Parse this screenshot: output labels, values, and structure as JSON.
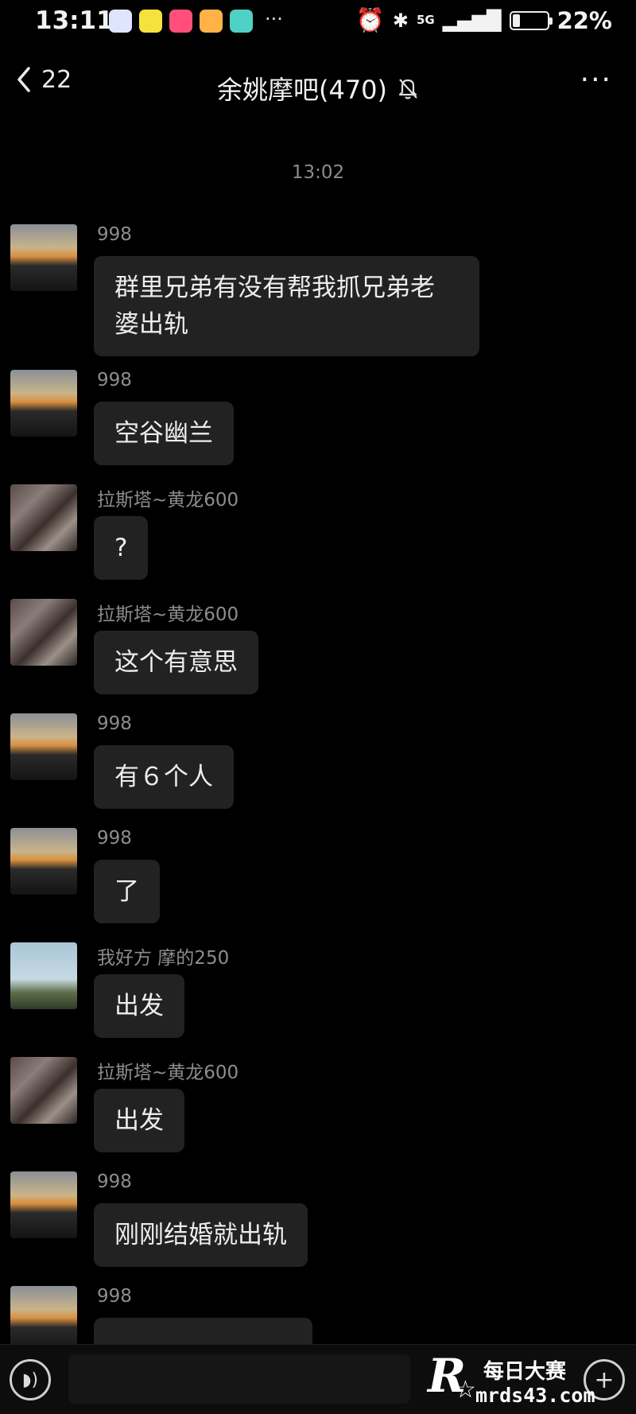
{
  "status_bar": {
    "time": "13:11",
    "network": "5G",
    "battery": "22%",
    "battery_level": 0.22,
    "app_icons": [
      "baidu-icon",
      "vip-icon",
      "video-icon",
      "game-icon",
      "message-icon"
    ]
  },
  "header": {
    "back_count": "22",
    "title": "余姚摩吧(470)",
    "mute_icon": "bell-off-icon",
    "more": "···"
  },
  "time_separator": "13:02",
  "messages": [
    {
      "sender": "998",
      "text": "群里兄弟有没有帮我抓兄弟老婆出轨",
      "avatar": "sunset"
    },
    {
      "sender": "998",
      "text": "空谷幽兰",
      "avatar": "sunset"
    },
    {
      "sender": "拉斯塔~黄龙600",
      "text": "?",
      "avatar": "motorbike"
    },
    {
      "sender": "拉斯塔~黄龙600",
      "text": "这个有意思",
      "avatar": "motorbike"
    },
    {
      "sender": "998",
      "text": "有６个人",
      "avatar": "sunset"
    },
    {
      "sender": "998",
      "text": "了",
      "avatar": "sunset"
    },
    {
      "sender": "我好方 摩的250",
      "text": "出发",
      "avatar": "sky"
    },
    {
      "sender": "拉斯塔~黄龙600",
      "text": "出发",
      "avatar": "motorbike"
    },
    {
      "sender": "998",
      "text": "刚刚结婚就出轨",
      "avatar": "sunset"
    },
    {
      "sender": "998",
      "text": "",
      "avatar": "sunset"
    }
  ],
  "watermark": {
    "letter": "R",
    "cn": "每日大赛",
    "url": "mrds43.com"
  },
  "colors": {
    "background": "#000000",
    "bubble": "#222222",
    "sender": "#8d8d8d"
  }
}
